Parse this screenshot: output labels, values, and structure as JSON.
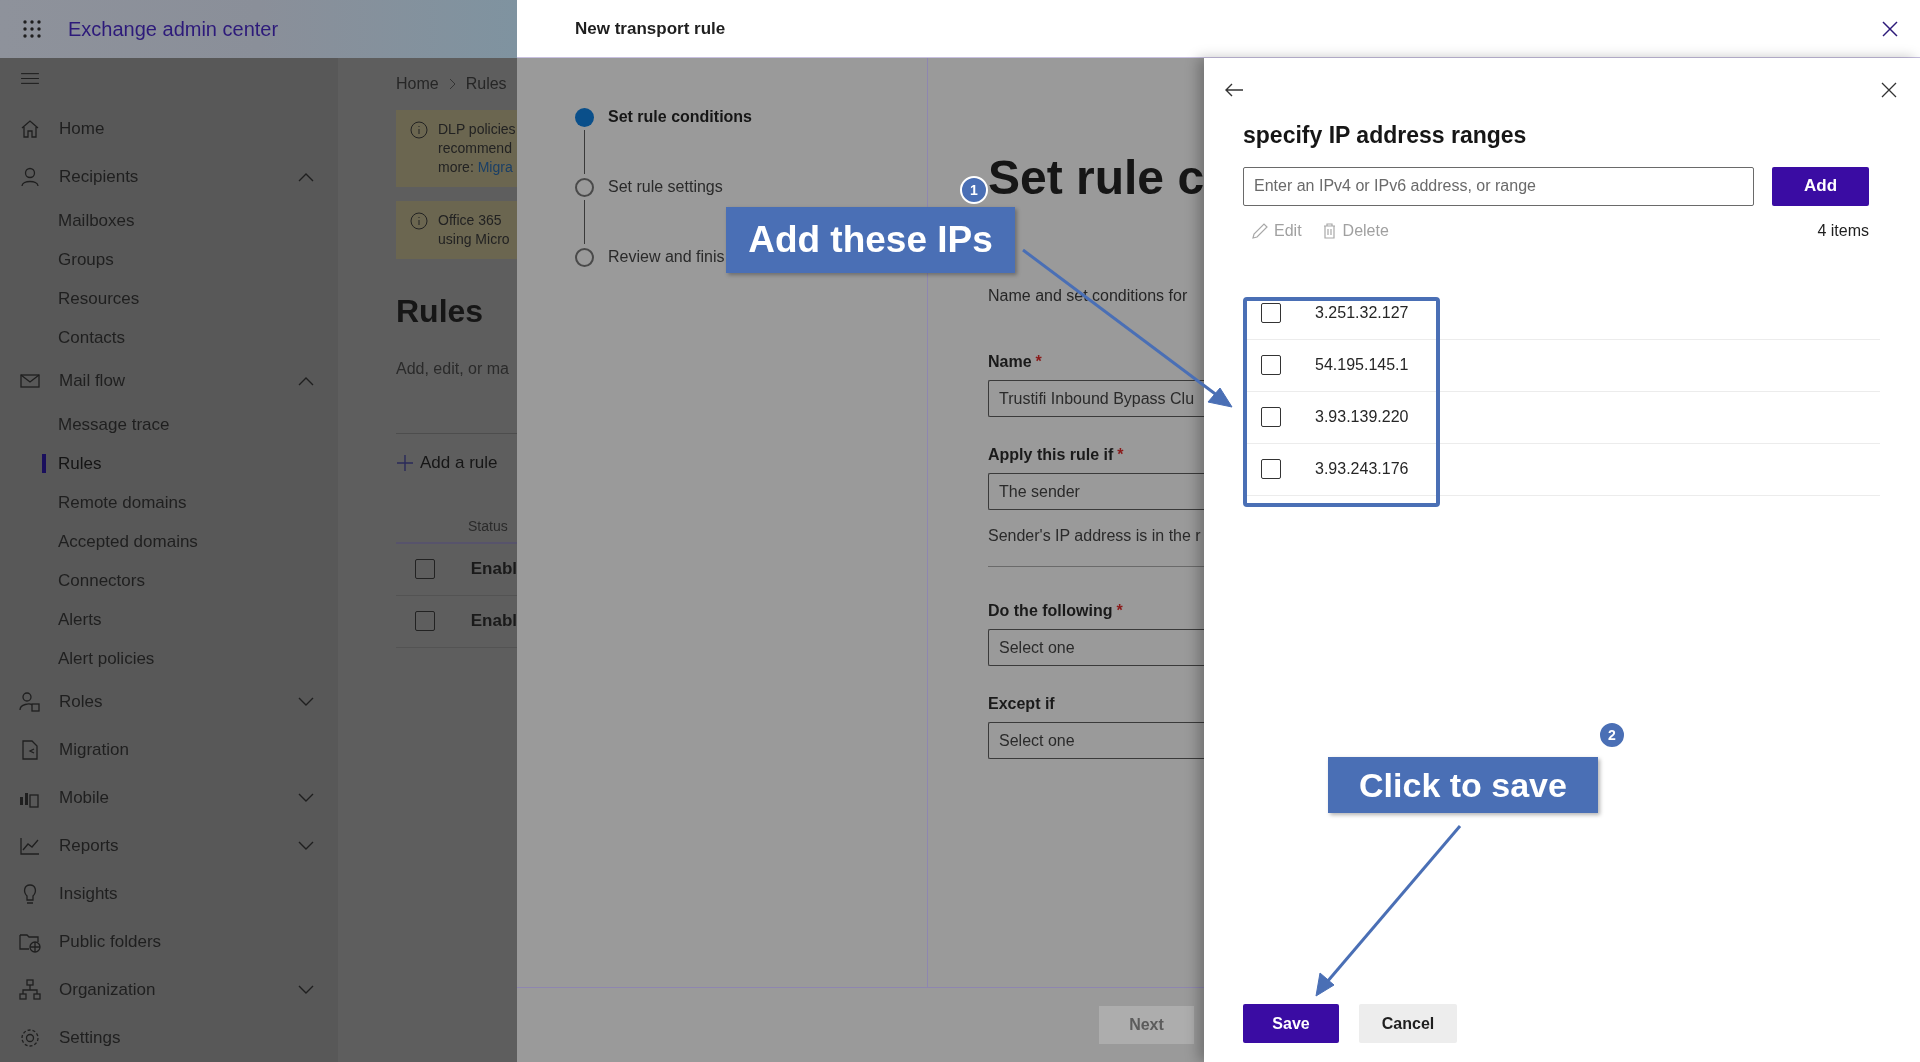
{
  "app_title": "Exchange admin center",
  "sidebar": {
    "items": [
      {
        "label": "Home",
        "selected": false
      },
      {
        "label": "Recipients",
        "selected": false,
        "expanded": true,
        "children": [
          {
            "label": "Mailboxes",
            "selected": false
          },
          {
            "label": "Groups",
            "selected": false
          },
          {
            "label": "Resources",
            "selected": false
          },
          {
            "label": "Contacts",
            "selected": false
          }
        ]
      },
      {
        "label": "Mail flow",
        "selected": false,
        "expanded": true,
        "children": [
          {
            "label": "Message trace",
            "selected": false
          },
          {
            "label": "Rules",
            "selected": true
          },
          {
            "label": "Remote domains",
            "selected": false
          },
          {
            "label": "Accepted domains",
            "selected": false
          },
          {
            "label": "Connectors",
            "selected": false
          },
          {
            "label": "Alerts",
            "selected": false
          },
          {
            "label": "Alert policies",
            "selected": false
          }
        ]
      },
      {
        "label": "Roles",
        "selected": false,
        "expanded": false
      },
      {
        "label": "Migration",
        "selected": false
      },
      {
        "label": "Mobile",
        "selected": false,
        "expanded": false
      },
      {
        "label": "Reports",
        "selected": false,
        "expanded": false
      },
      {
        "label": "Insights",
        "selected": false
      },
      {
        "label": "Public folders",
        "selected": false
      },
      {
        "label": "Organization",
        "selected": false,
        "expanded": false
      },
      {
        "label": "Settings",
        "selected": false
      }
    ]
  },
  "background_page": {
    "breadcrumb": [
      "Home",
      "Rules"
    ],
    "banners": [
      {
        "lines": [
          "DLP policies",
          "recommend",
          "more: "
        ],
        "link": "Migra"
      },
      {
        "lines": [
          "Office 365",
          "using Micro"
        ]
      }
    ],
    "title": "Rules",
    "description": "Add, edit, or ma",
    "add_button": "Add a rule",
    "column": "Status",
    "rows": [
      {
        "status": "Enabl",
        "checked": false
      },
      {
        "status": "Enabl",
        "checked": false
      }
    ]
  },
  "transport_rule": {
    "title": "New transport rule",
    "steps": [
      {
        "label": "Set rule conditions",
        "selected": true
      },
      {
        "label": "Set rule settings",
        "selected": false
      },
      {
        "label": "Review and finis",
        "selected": false
      }
    ],
    "heading": "Set rule c",
    "description": "Name and set conditions for",
    "fields": [
      {
        "label": "Name",
        "required_mark": "*",
        "value": "Trustifi Inbound Bypass Clu"
      },
      {
        "label": "Apply this rule if",
        "required_mark": "*",
        "value": "The sender",
        "helper": "Sender's IP address is in the r"
      },
      {
        "label": "Do the following",
        "required_mark": "*",
        "value": "Select one"
      },
      {
        "label": "Except if",
        "value": "Select one"
      }
    ],
    "next_button": {
      "label": "Next",
      "disabled": true
    }
  },
  "ip_panel": {
    "title": "specify IP address ranges",
    "placeholder": "Enter an IPv4 or IPv6 address, or range",
    "add_button": "Add",
    "toolbar": [
      {
        "label": "Edit",
        "disabled": true
      },
      {
        "label": "Delete",
        "disabled": true
      }
    ],
    "count": "4 items",
    "rows": [
      {
        "address": "3.251.32.127",
        "checked": false
      },
      {
        "address": "54.195.145.1",
        "checked": false
      },
      {
        "address": "3.93.139.220",
        "checked": false
      },
      {
        "address": "3.93.243.176",
        "checked": false
      }
    ],
    "save_button": "Save",
    "cancel_button": "Cancel"
  },
  "callouts": [
    {
      "text": "Add these IPs",
      "badge": "1"
    },
    {
      "text": "Click to save",
      "badge": "2"
    }
  ]
}
